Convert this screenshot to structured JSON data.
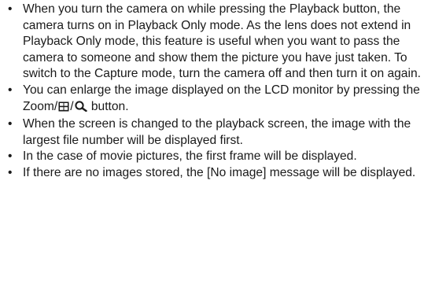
{
  "notes": {
    "item1": "When you turn the camera on while pressing the Playback button, the camera turns on in Playback Only mode. As the lens does not extend in Playback Only mode, this feature is useful when you want to pass the camera to someone and show them the picture you have just taken. To switch to the Capture mode, turn the camera off and then turn it on again.",
    "item2": {
      "before": "You can enlarge the image displayed on the LCD monitor by pressing the Zoom/",
      "separator": "/",
      "after": " button.",
      "icon1": "thumbnail-grid-icon",
      "icon2": "magnifier-icon"
    },
    "item3": "When the screen is changed to the playback screen, the image with the largest file number will be displayed first.",
    "item4": "In the case of movie pictures, the first frame will be displayed.",
    "item5": "If there are no images stored, the [No image] message will be displayed.",
    "bullet": "•"
  }
}
